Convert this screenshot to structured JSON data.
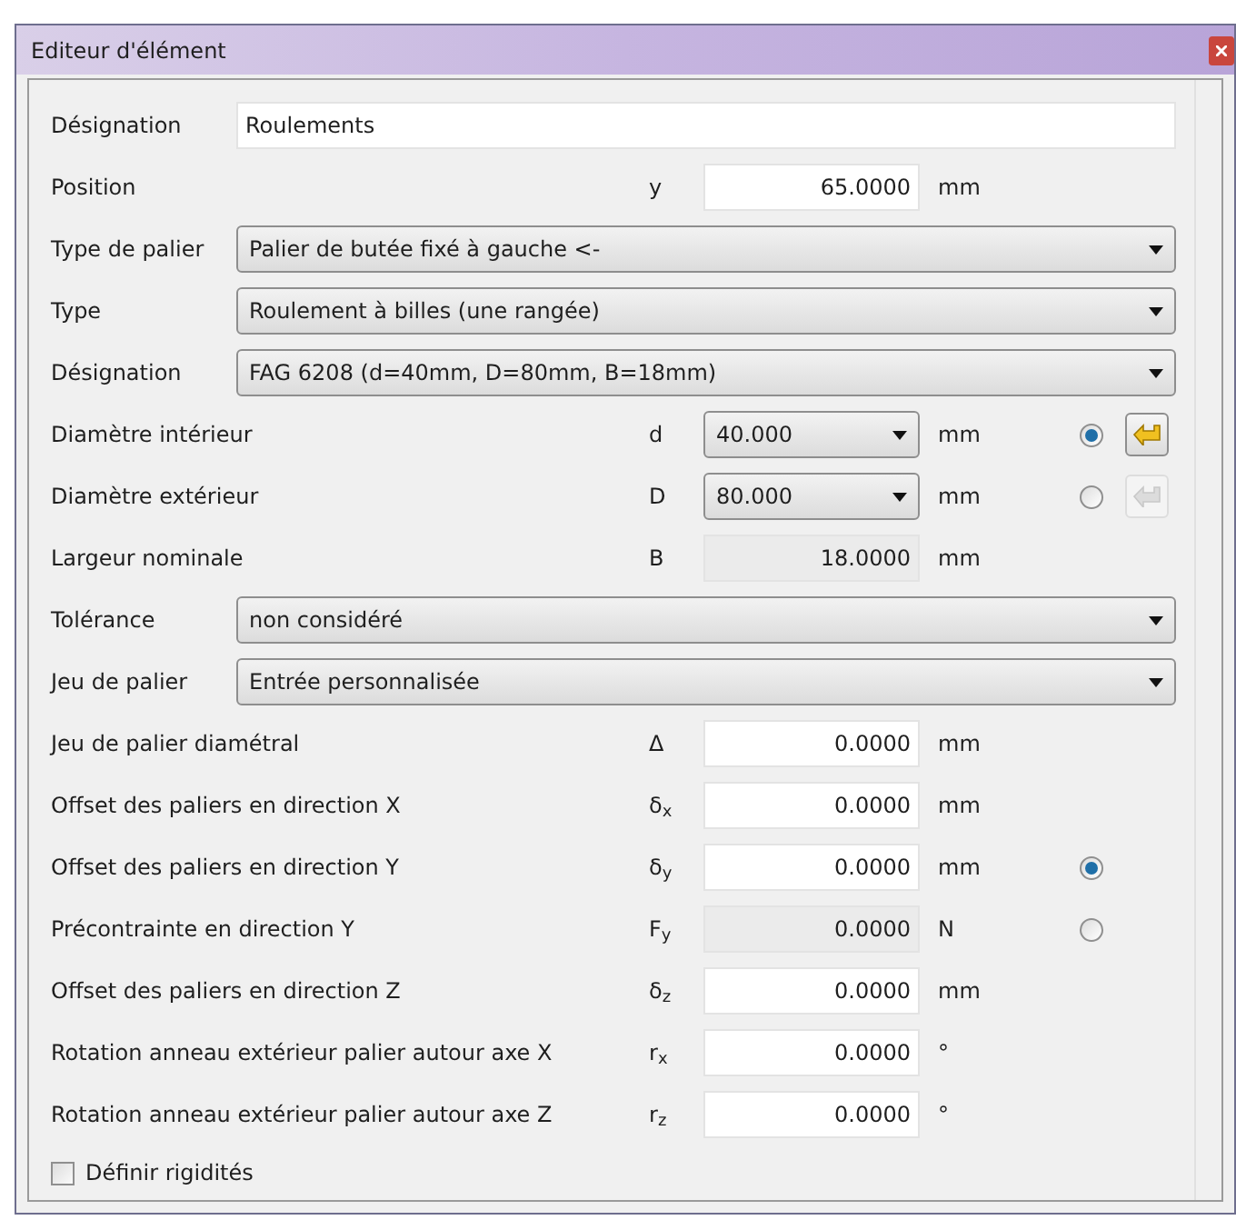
{
  "window": {
    "title": "Editeur d'élément"
  },
  "rows": [
    {
      "kind": "text",
      "label": "Désignation",
      "value": "Roulements"
    },
    {
      "kind": "value",
      "label": "Position",
      "symbol": "y",
      "field": {
        "kind": "input",
        "value": "65.0000"
      },
      "unit": "mm"
    },
    {
      "kind": "select",
      "label": "Type de palier",
      "value": "Palier de butée fixé à gauche <-"
    },
    {
      "kind": "select",
      "label": "Type",
      "value": "Roulement à billes (une rangée)"
    },
    {
      "kind": "select",
      "label": "Désignation",
      "value": "FAG 6208 (d=40mm, D=80mm, B=18mm)"
    },
    {
      "kind": "value",
      "label": "Diamètre intérieur",
      "symbol": "d",
      "field": {
        "kind": "combo",
        "value": "40.000"
      },
      "unit": "mm",
      "radio": {
        "selected": true
      },
      "apply": {
        "disabled": false
      }
    },
    {
      "kind": "value",
      "label": "Diamètre extérieur",
      "symbol": "D",
      "field": {
        "kind": "combo",
        "value": "80.000"
      },
      "unit": "mm",
      "radio": {
        "selected": false
      },
      "apply": {
        "disabled": true
      }
    },
    {
      "kind": "value",
      "label": "Largeur nominale",
      "symbol": "B",
      "field": {
        "kind": "readonly",
        "value": "18.0000"
      },
      "unit": "mm"
    },
    {
      "kind": "select",
      "label": "Tolérance",
      "value": "non considéré"
    },
    {
      "kind": "select",
      "label": "Jeu de palier",
      "value": "Entrée personnalisée"
    },
    {
      "kind": "value",
      "label": "Jeu de palier diamétral",
      "symbol": "Δ",
      "field": {
        "kind": "input",
        "value": "0.0000"
      },
      "unit": "mm"
    },
    {
      "kind": "value",
      "label": "Offset des paliers en direction X",
      "symbol": "δ$_{x}$",
      "field": {
        "kind": "input",
        "value": "0.0000"
      },
      "unit": "mm"
    },
    {
      "kind": "value",
      "label": "Offset des paliers en direction Y",
      "symbol": "δ$_{y}$",
      "field": {
        "kind": "input",
        "value": "0.0000"
      },
      "unit": "mm",
      "radio": {
        "selected": true
      }
    },
    {
      "kind": "value",
      "label": "Précontrainte en direction Y",
      "symbol": "F$_{y}$",
      "field": {
        "kind": "readonly",
        "value": "0.0000"
      },
      "unit": "N",
      "radio": {
        "selected": false
      }
    },
    {
      "kind": "value",
      "label": "Offset des paliers en direction Z",
      "symbol": "δ$_{z}$",
      "field": {
        "kind": "input",
        "value": "0.0000"
      },
      "unit": "mm"
    },
    {
      "kind": "value",
      "label": "Rotation anneau extérieur palier autour axe X",
      "symbol": "r$_{x}$",
      "field": {
        "kind": "input",
        "value": "0.0000"
      },
      "unit": "°"
    },
    {
      "kind": "value",
      "label": "Rotation anneau extérieur palier autour axe Z",
      "symbol": "r$_{z}$",
      "field": {
        "kind": "input",
        "value": "0.0000"
      },
      "unit": "°"
    },
    {
      "kind": "checkbox",
      "label": "Définir rigidités",
      "checked": false
    }
  ]
}
